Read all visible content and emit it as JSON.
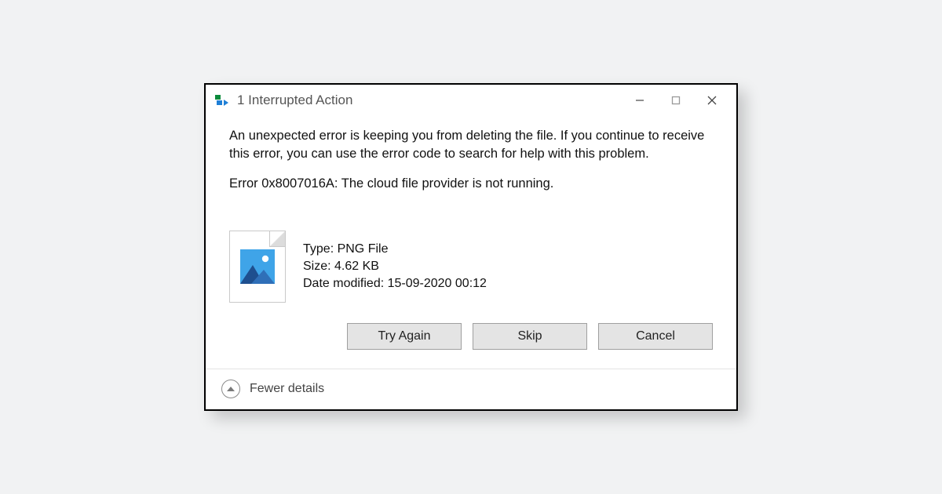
{
  "titlebar": {
    "title": "1 Interrupted Action"
  },
  "body": {
    "message": "An unexpected error is keeping you from deleting the file. If you continue to receive this error, you can use the error code to search for help with this problem.",
    "error_line": "Error 0x8007016A: The cloud file provider is not running."
  },
  "file": {
    "type_line": "Type: PNG File",
    "size_line": "Size: 4.62 KB",
    "modified_line": "Date modified: 15-09-2020 00:12"
  },
  "buttons": {
    "try_again": "Try Again",
    "skip": "Skip",
    "cancel": "Cancel"
  },
  "footer": {
    "fewer_details": "Fewer details"
  }
}
